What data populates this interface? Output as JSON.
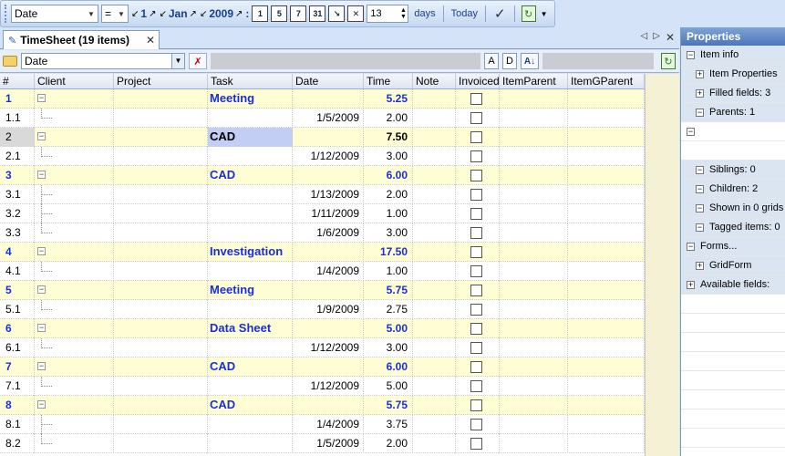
{
  "toolbar": {
    "field_combo": "Date",
    "operator": "=",
    "day": "1",
    "month": "Jan",
    "year": "2009",
    "quick_btns": [
      "1",
      "5",
      "7",
      "31"
    ],
    "spin_value": "13",
    "days_label": "days",
    "today_label": "Today"
  },
  "tab": {
    "label": "TimeSheet (19 items)"
  },
  "filter": {
    "field": "Date",
    "a_label": "A",
    "d_label": "D"
  },
  "columns": [
    "#",
    "Client",
    "Project",
    "Task",
    "Date",
    "Time",
    "Note",
    "Invoiced",
    "ItemParent",
    "ItemGParent"
  ],
  "rows": [
    {
      "num": "1",
      "task": "Meeting",
      "date": "",
      "time": "5.25",
      "type": "parent"
    },
    {
      "num": "1.1",
      "task": "",
      "date": "1/5/2009",
      "time": "2.00",
      "type": "child"
    },
    {
      "num": "2",
      "task": "CAD",
      "date": "",
      "time": "7.50",
      "type": "parent selected"
    },
    {
      "num": "2.1",
      "task": "",
      "date": "1/12/2009",
      "time": "3.00",
      "type": "child"
    },
    {
      "num": "3",
      "task": "CAD",
      "date": "",
      "time": "6.00",
      "type": "parent"
    },
    {
      "num": "3.1",
      "task": "",
      "date": "1/13/2009",
      "time": "2.00",
      "type": "child"
    },
    {
      "num": "3.2",
      "task": "",
      "date": "1/11/2009",
      "time": "1.00",
      "type": "child"
    },
    {
      "num": "3.3",
      "task": "",
      "date": "1/6/2009",
      "time": "3.00",
      "type": "child"
    },
    {
      "num": "4",
      "task": "Investigation",
      "date": "",
      "time": "17.50",
      "type": "parent"
    },
    {
      "num": "4.1",
      "task": "",
      "date": "1/4/2009",
      "time": "1.00",
      "type": "child"
    },
    {
      "num": "5",
      "task": "Meeting",
      "date": "",
      "time": "5.75",
      "type": "parent"
    },
    {
      "num": "5.1",
      "task": "",
      "date": "1/9/2009",
      "time": "2.75",
      "type": "child"
    },
    {
      "num": "6",
      "task": "Data Sheet",
      "date": "",
      "time": "5.00",
      "type": "parent"
    },
    {
      "num": "6.1",
      "task": "",
      "date": "1/12/2009",
      "time": "3.00",
      "type": "child"
    },
    {
      "num": "7",
      "task": "CAD",
      "date": "",
      "time": "6.00",
      "type": "parent"
    },
    {
      "num": "7.1",
      "task": "",
      "date": "1/12/2009",
      "time": "5.00",
      "type": "child"
    },
    {
      "num": "8",
      "task": "CAD",
      "date": "",
      "time": "5.75",
      "type": "parent"
    },
    {
      "num": "8.1",
      "task": "",
      "date": "1/4/2009",
      "time": "3.75",
      "type": "child"
    },
    {
      "num": "8.2",
      "task": "",
      "date": "1/5/2009",
      "time": "2.00",
      "type": "child"
    }
  ],
  "properties": {
    "title": "Properties",
    "items": [
      {
        "label": "Item info",
        "kind": "group",
        "exp": "−"
      },
      {
        "label": "Item Properties",
        "kind": "sub",
        "exp": "+"
      },
      {
        "label": "Filled fields: 3",
        "kind": "sub",
        "exp": "+"
      },
      {
        "label": "Parents: 1",
        "kind": "sub",
        "exp": "−"
      },
      {
        "label": "",
        "kind": "blank",
        "exp": "−"
      },
      {
        "label": "",
        "kind": "blank",
        "exp": ""
      },
      {
        "label": "Siblings: 0",
        "kind": "sub",
        "exp": "−"
      },
      {
        "label": "Children: 2",
        "kind": "sub",
        "exp": "−"
      },
      {
        "label": "Shown in 0 grids",
        "kind": "sub",
        "exp": "−"
      },
      {
        "label": "Tagged items: 0",
        "kind": "sub",
        "exp": "−"
      },
      {
        "label": "Forms...",
        "kind": "group",
        "exp": "−"
      },
      {
        "label": "GridForm",
        "kind": "sub",
        "exp": "+"
      },
      {
        "label": "Available fields:",
        "kind": "group",
        "exp": "+"
      }
    ]
  },
  "colors": {
    "parent_row": "#fffdd4",
    "parent_text": "#1a2fd8",
    "panel_bg": "#d4e3f7"
  }
}
